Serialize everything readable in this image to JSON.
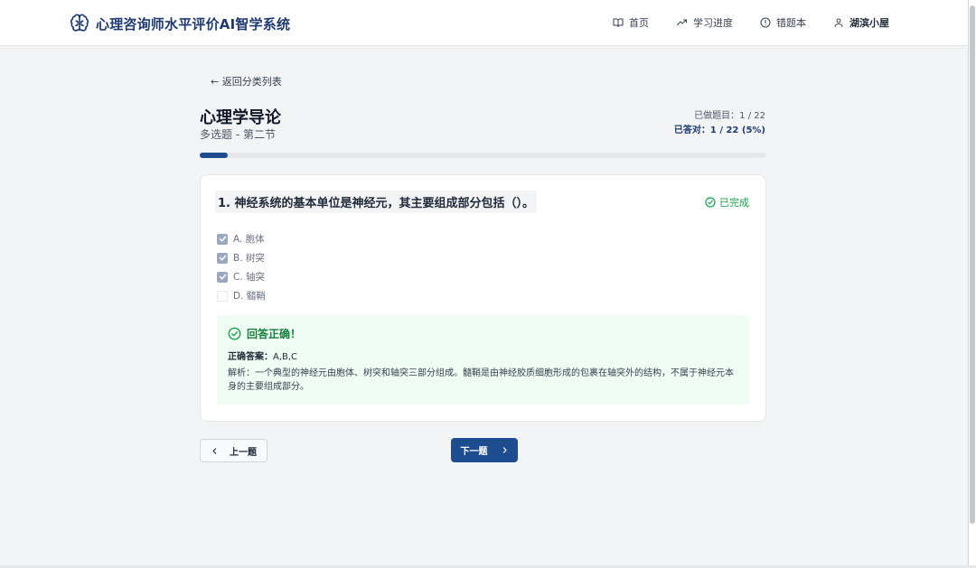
{
  "app": {
    "title": "心理咨询师水平评价AI智学系统"
  },
  "nav": [
    {
      "label": "首页",
      "icon": "book-open-icon"
    },
    {
      "label": "学习进度",
      "icon": "trend-up-icon"
    },
    {
      "label": "错题本",
      "icon": "alert-circle-icon"
    },
    {
      "label": "湖滨小屋",
      "icon": "user-icon"
    }
  ],
  "back_label": "← 返回分类列表",
  "page": {
    "title": "心理学导论",
    "subtitle": "多选题 - 第二节"
  },
  "stats": {
    "done": "已做题目：1 / 22",
    "correct": "已答对：1 / 22 (5%)"
  },
  "progress": {
    "fraction": 0.05
  },
  "question": {
    "text": "1. 神经系统的基本单位是神经元，其主要组成部分包括（）。",
    "status": "已完成",
    "options": [
      {
        "label": "A. 胞体",
        "checked": true
      },
      {
        "label": "B. 树突",
        "checked": true
      },
      {
        "label": "C. 轴突",
        "checked": true
      },
      {
        "label": "D. 髓鞘",
        "checked": false
      }
    ]
  },
  "feedback": {
    "title": "回答正确！",
    "answer_label": "正确答案：",
    "answer_value": "A,B,C",
    "analysis": "解析：一个典型的神经元由胞体、树突和轴突三部分组成。髓鞘是由神经胶质细胞形成的包裹在轴突外的结构，不属于神经元本身的主要组成部分。"
  },
  "buttons": {
    "prev": "上一题",
    "next": "下一题"
  },
  "colors": {
    "brand": "#1e3a6e",
    "primary": "#1e4d8f",
    "success": "#16a34a",
    "success_bg": "#f0fdf4"
  }
}
